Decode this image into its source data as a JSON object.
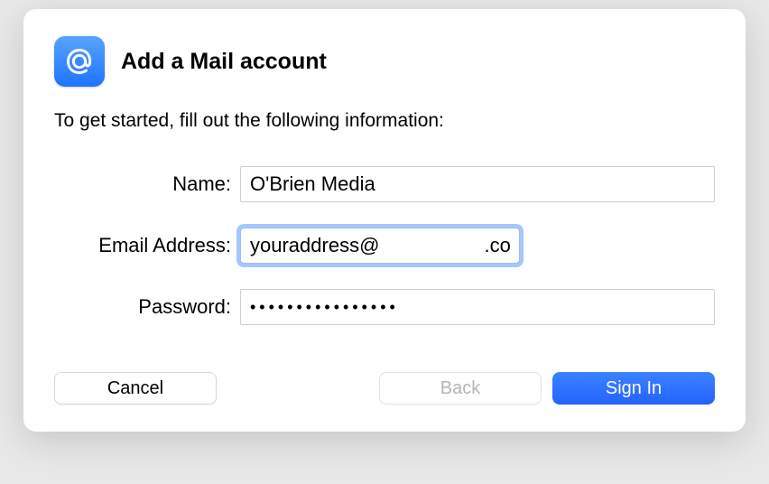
{
  "dialog": {
    "title": "Add a Mail account",
    "subtitle": "To get started, fill out the following information:",
    "fields": {
      "name": {
        "label": "Name:",
        "value": "O'Brien Media"
      },
      "email": {
        "label": "Email Address:",
        "value": "youraddress@                   .co.uk"
      },
      "password": {
        "label": "Password:",
        "value": "••••••••••••••••"
      }
    },
    "buttons": {
      "cancel": "Cancel",
      "back": "Back",
      "signin": "Sign In"
    }
  }
}
